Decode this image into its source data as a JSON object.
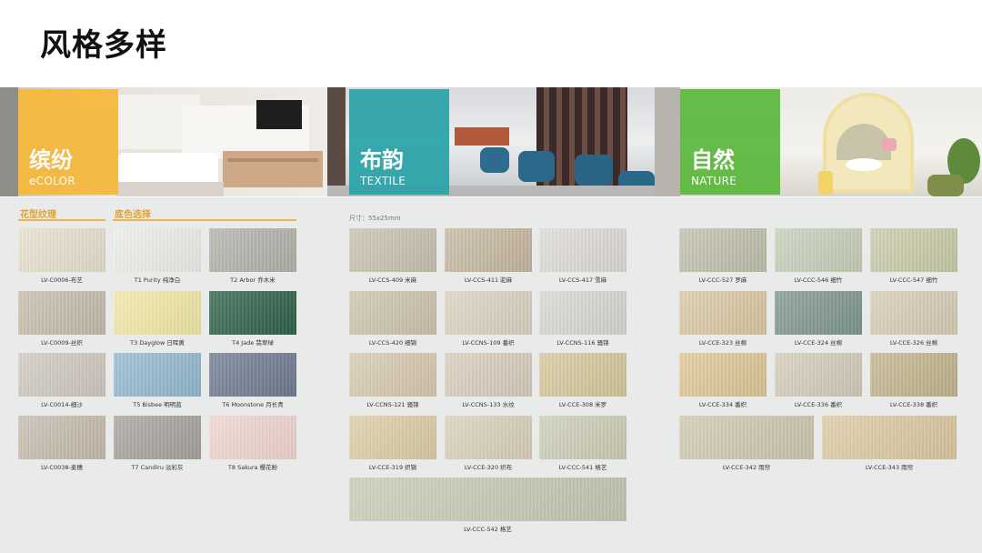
{
  "title": "风格多样",
  "banner": {
    "sections": [
      {
        "zh": "缤纷",
        "en": "eCOLOR",
        "color": "#f5b83a"
      },
      {
        "zh": "布韵",
        "en": "TEXTILE",
        "color": "#2aa3a8"
      },
      {
        "zh": "自然",
        "en": "NATURE",
        "color": "#5cb83c"
      }
    ]
  },
  "left": {
    "heading_pattern": "花型纹理",
    "heading_color": "底色选择"
  },
  "size_note": "尺寸：55x25mm",
  "swatches": [
    {
      "label": "LV-C0006-布艺",
      "color": "#e6e0cc"
    },
    {
      "label": "T1 Purity 纯净白",
      "color": "#ededea"
    },
    {
      "label": "T2 Arbor 乔木米",
      "color": "#b3b1aa"
    },
    {
      "label": "LV-C0009-丝织",
      "color": "#c5bcac"
    },
    {
      "label": "T3 Dayglow 日晖黄",
      "color": "#f1e8a6"
    },
    {
      "label": "T4 Jade 翡翠绿",
      "color": "#2f6149"
    },
    {
      "label": "LV-C0014-细沙",
      "color": "#cfc9c0"
    },
    {
      "label": "T5 Bisbee 明明蓝",
      "color": "#93b9d0"
    },
    {
      "label": "T6 Moonstone 月长青",
      "color": "#6f7b90"
    },
    {
      "label": "LV-C0038-麦穗",
      "color": "#c6bcad"
    },
    {
      "label": "T7 Candiru 淡彩灰",
      "color": "#a7a29d"
    },
    {
      "label": "T8 Sakura 樱花粉",
      "color": "#f0d5d0"
    },
    {
      "label": "LV-CCS-409 米麻",
      "color": "#c9c1b0"
    },
    {
      "label": "LV-CCS-411 驼麻",
      "color": "#c6b8a1"
    },
    {
      "label": "LV-CCS-417 雪麻",
      "color": "#dedbd5"
    },
    {
      "label": "LV-CCS-420 细锦",
      "color": "#cdc4ae"
    },
    {
      "label": "LV-CCNS-109 番织",
      "color": "#dcd2c1"
    },
    {
      "label": "LV-CCNS-116 骚锦",
      "color": "#d7d7d4"
    },
    {
      "label": "LV-CCNS-121 骚锦",
      "color": "#d7c9af"
    },
    {
      "label": "LV-CCNS-133 水纹",
      "color": "#d8cdbd"
    },
    {
      "label": "LV-CCE-308 米罗",
      "color": "#d6c89c"
    },
    {
      "label": "LV-CCE-319 织锦",
      "color": "#ddcda6"
    },
    {
      "label": "LV-CCE-320 织布",
      "color": "#dad1bb"
    },
    {
      "label": "LV-CCC-541 格艺",
      "color": "#cdcdb7"
    },
    {
      "label": "LV-CCC-542 格艺",
      "color": "#c8c9b4"
    },
    {
      "label": "LV-CCC-527 罗麻",
      "color": "#c1c0ad"
    },
    {
      "label": "LV-CCC-546 细竹",
      "color": "#c7cfba"
    },
    {
      "label": "LV-CCC-547 细竹",
      "color": "#c9cba9"
    },
    {
      "label": "LV-CCE-323 丝棉",
      "color": "#d9c8a3"
    },
    {
      "label": "LV-CCE-324 丝棉",
      "color": "#7f9690"
    },
    {
      "label": "LV-CCE-326 丝棉",
      "color": "#d7cdb6"
    },
    {
      "label": "LV-CCE-334 番织",
      "color": "#dec796"
    },
    {
      "label": "LV-CCE-336 番织",
      "color": "#d3ccbb"
    },
    {
      "label": "LV-CCE-338 番织",
      "color": "#c3b48d"
    },
    {
      "label": "LV-CCE-342 雨帘",
      "color": "#d0c7b2"
    },
    {
      "label": "LV-CCE-343 雨帘",
      "color": "#dbc9a2"
    }
  ]
}
